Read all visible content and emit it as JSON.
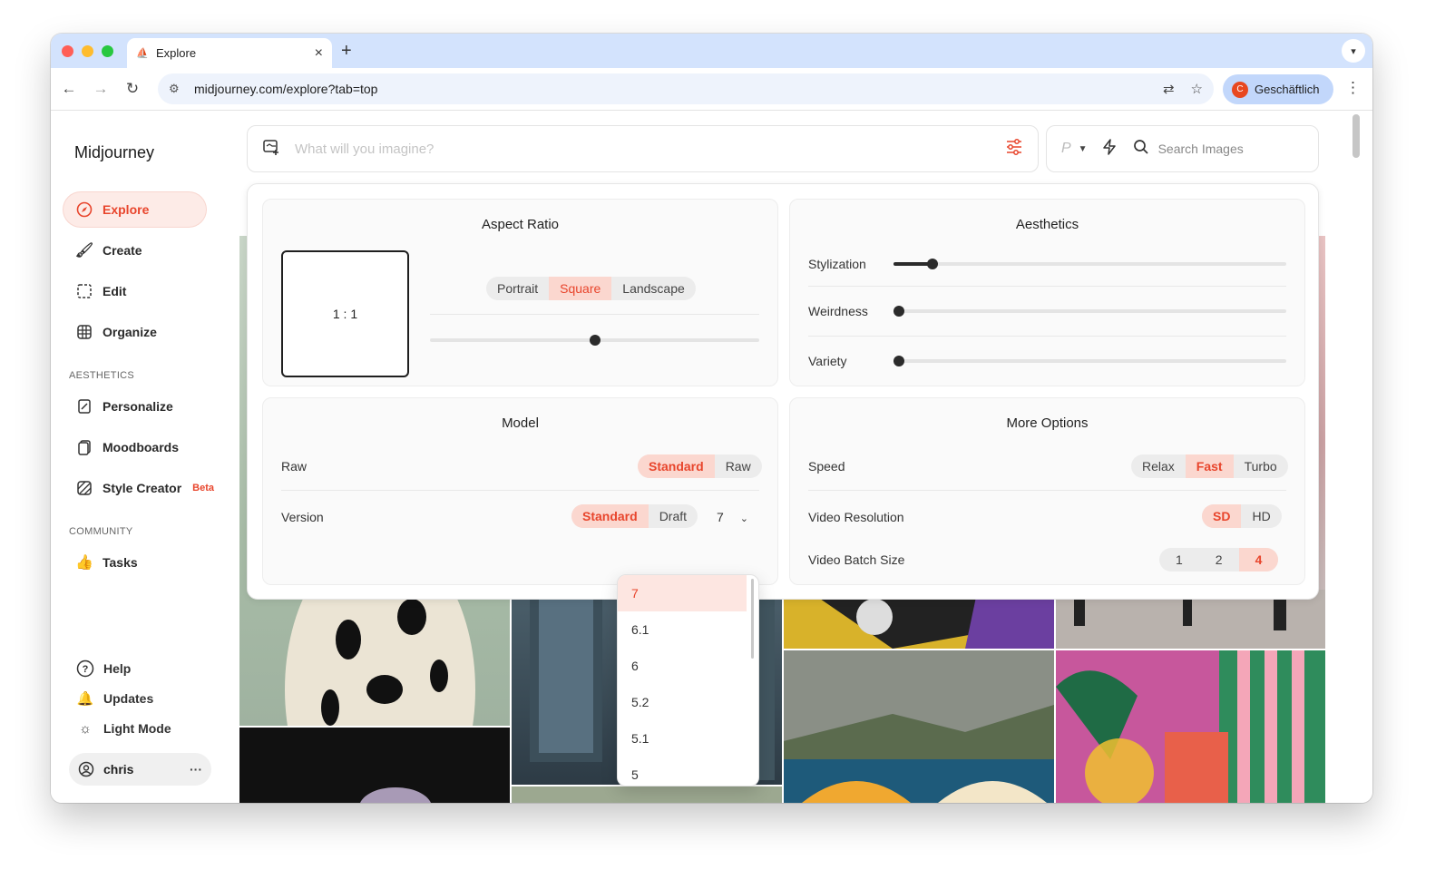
{
  "browser": {
    "tab_title": "Explore",
    "url": "midjourney.com/explore?tab=top",
    "profile_initial": "C",
    "profile_name": "Geschäftlich"
  },
  "sidebar": {
    "logo": "Midjourney",
    "nav": [
      {
        "label": "Explore",
        "icon": "compass-icon",
        "active": true
      },
      {
        "label": "Create",
        "icon": "brush-icon"
      },
      {
        "label": "Edit",
        "icon": "edit-icon"
      },
      {
        "label": "Organize",
        "icon": "grid-icon"
      }
    ],
    "aesthetics_heading": "AESTHETICS",
    "aesthetics": [
      {
        "label": "Personalize",
        "icon": "personalize-icon"
      },
      {
        "label": "Moodboards",
        "icon": "moodboard-icon"
      },
      {
        "label": "Style Creator",
        "icon": "style-creator-icon",
        "badge": "Beta"
      }
    ],
    "community_heading": "COMMUNITY",
    "community": [
      {
        "label": "Tasks",
        "icon": "thumbs-up-icon"
      }
    ],
    "bottom": [
      {
        "label": "Help",
        "icon": "help-icon"
      },
      {
        "label": "Updates",
        "icon": "bell-icon"
      },
      {
        "label": "Light Mode",
        "icon": "sun-icon"
      }
    ],
    "user": "chris"
  },
  "prompt": {
    "placeholder": "What will you imagine?"
  },
  "search": {
    "placeholder": "Search Images",
    "personalize_letter": "P"
  },
  "settings": {
    "aspect": {
      "title": "Aspect Ratio",
      "ratio": "1 : 1",
      "options": [
        "Portrait",
        "Square",
        "Landscape"
      ],
      "selected": "Square",
      "slider_value": 0.5
    },
    "aesthetics": {
      "title": "Aesthetics",
      "sliders": [
        {
          "label": "Stylization",
          "value": 0.1
        },
        {
          "label": "Weirdness",
          "value": 0
        },
        {
          "label": "Variety",
          "value": 0
        }
      ]
    },
    "model": {
      "title": "Model",
      "raw_label": "Raw",
      "raw_options": [
        "Standard",
        "Raw"
      ],
      "raw_selected": "Standard",
      "version_label": "Version",
      "version_options": [
        "Standard",
        "Draft"
      ],
      "version_selected": "Standard",
      "version_value": "7",
      "version_list": [
        "7",
        "6.1",
        "6",
        "5.2",
        "5.1",
        "5"
      ]
    },
    "more": {
      "title": "More Options",
      "speed_label": "Speed",
      "speed_options": [
        "Relax",
        "Fast",
        "Turbo"
      ],
      "speed_selected": "Fast",
      "res_label": "Video Resolution",
      "res_options": [
        "SD",
        "HD"
      ],
      "res_selected": "SD",
      "batch_label": "Video Batch Size",
      "batch_options": [
        "1",
        "2",
        "4"
      ],
      "batch_selected": "4"
    }
  },
  "colors": {
    "accent": "#e8452c",
    "accent_bg": "#fbd7cf",
    "chrome": "#d3e3fd"
  }
}
